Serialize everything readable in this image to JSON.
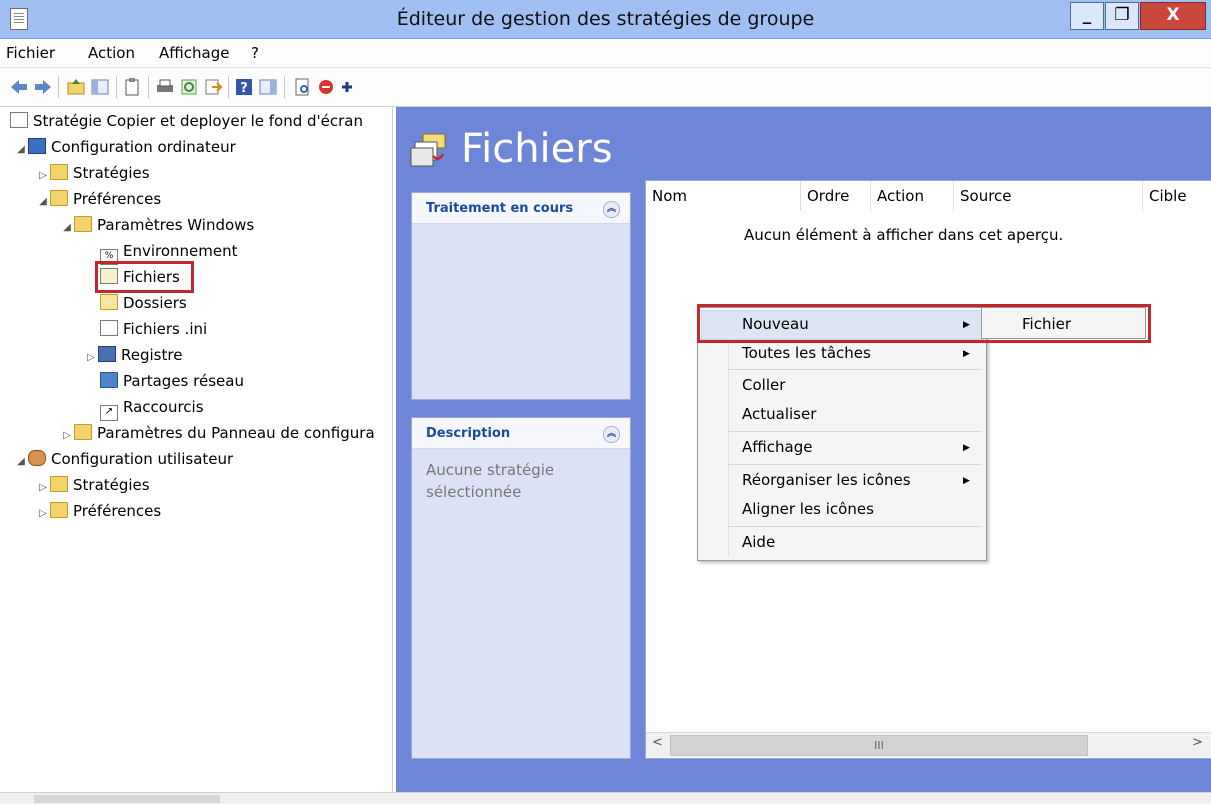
{
  "window": {
    "title": "Éditeur de gestion des stratégies de groupe"
  },
  "menubar": [
    "Fichier",
    "Action",
    "Affichage",
    "?"
  ],
  "tree": {
    "root": "Stratégie Copier et deployer le fond d'écran",
    "computer_config": "Configuration ordinateur",
    "cc_strategies": "Stratégies",
    "cc_preferences": "Préférences",
    "windows_settings": "Paramètres Windows",
    "environment": "Environnement",
    "files": "Fichiers",
    "folders": "Dossiers",
    "ini_files": "Fichiers .ini",
    "registry": "Registre",
    "network_shares": "Partages réseau",
    "shortcuts": "Raccourcis",
    "control_panel": "Paramètres du Panneau de configura",
    "user_config": "Configuration utilisateur",
    "uc_strategies": "Stratégies",
    "uc_preferences": "Préférences"
  },
  "main": {
    "title": "Fichiers",
    "processing_panel": "Traitement en cours",
    "description_panel": "Description",
    "description_text": "Aucune stratégie sélectionnée",
    "columns": [
      "Nom",
      "Ordre",
      "Action",
      "Source",
      "Cible"
    ],
    "empty_message": "Aucun élément à afficher dans cet aperçu.",
    "scroll_thumb": "III"
  },
  "context_menu": {
    "items": [
      "Nouveau",
      "Toutes les tâches",
      "Coller",
      "Actualiser",
      "Affichage",
      "Réorganiser les icônes",
      "Aligner les icônes",
      "Aide"
    ],
    "submenu_item": "Fichier"
  },
  "colors": {
    "title_bar": "#9fc0f0",
    "main_pane": "#6d86d8",
    "highlight_box": "#c1272d"
  }
}
